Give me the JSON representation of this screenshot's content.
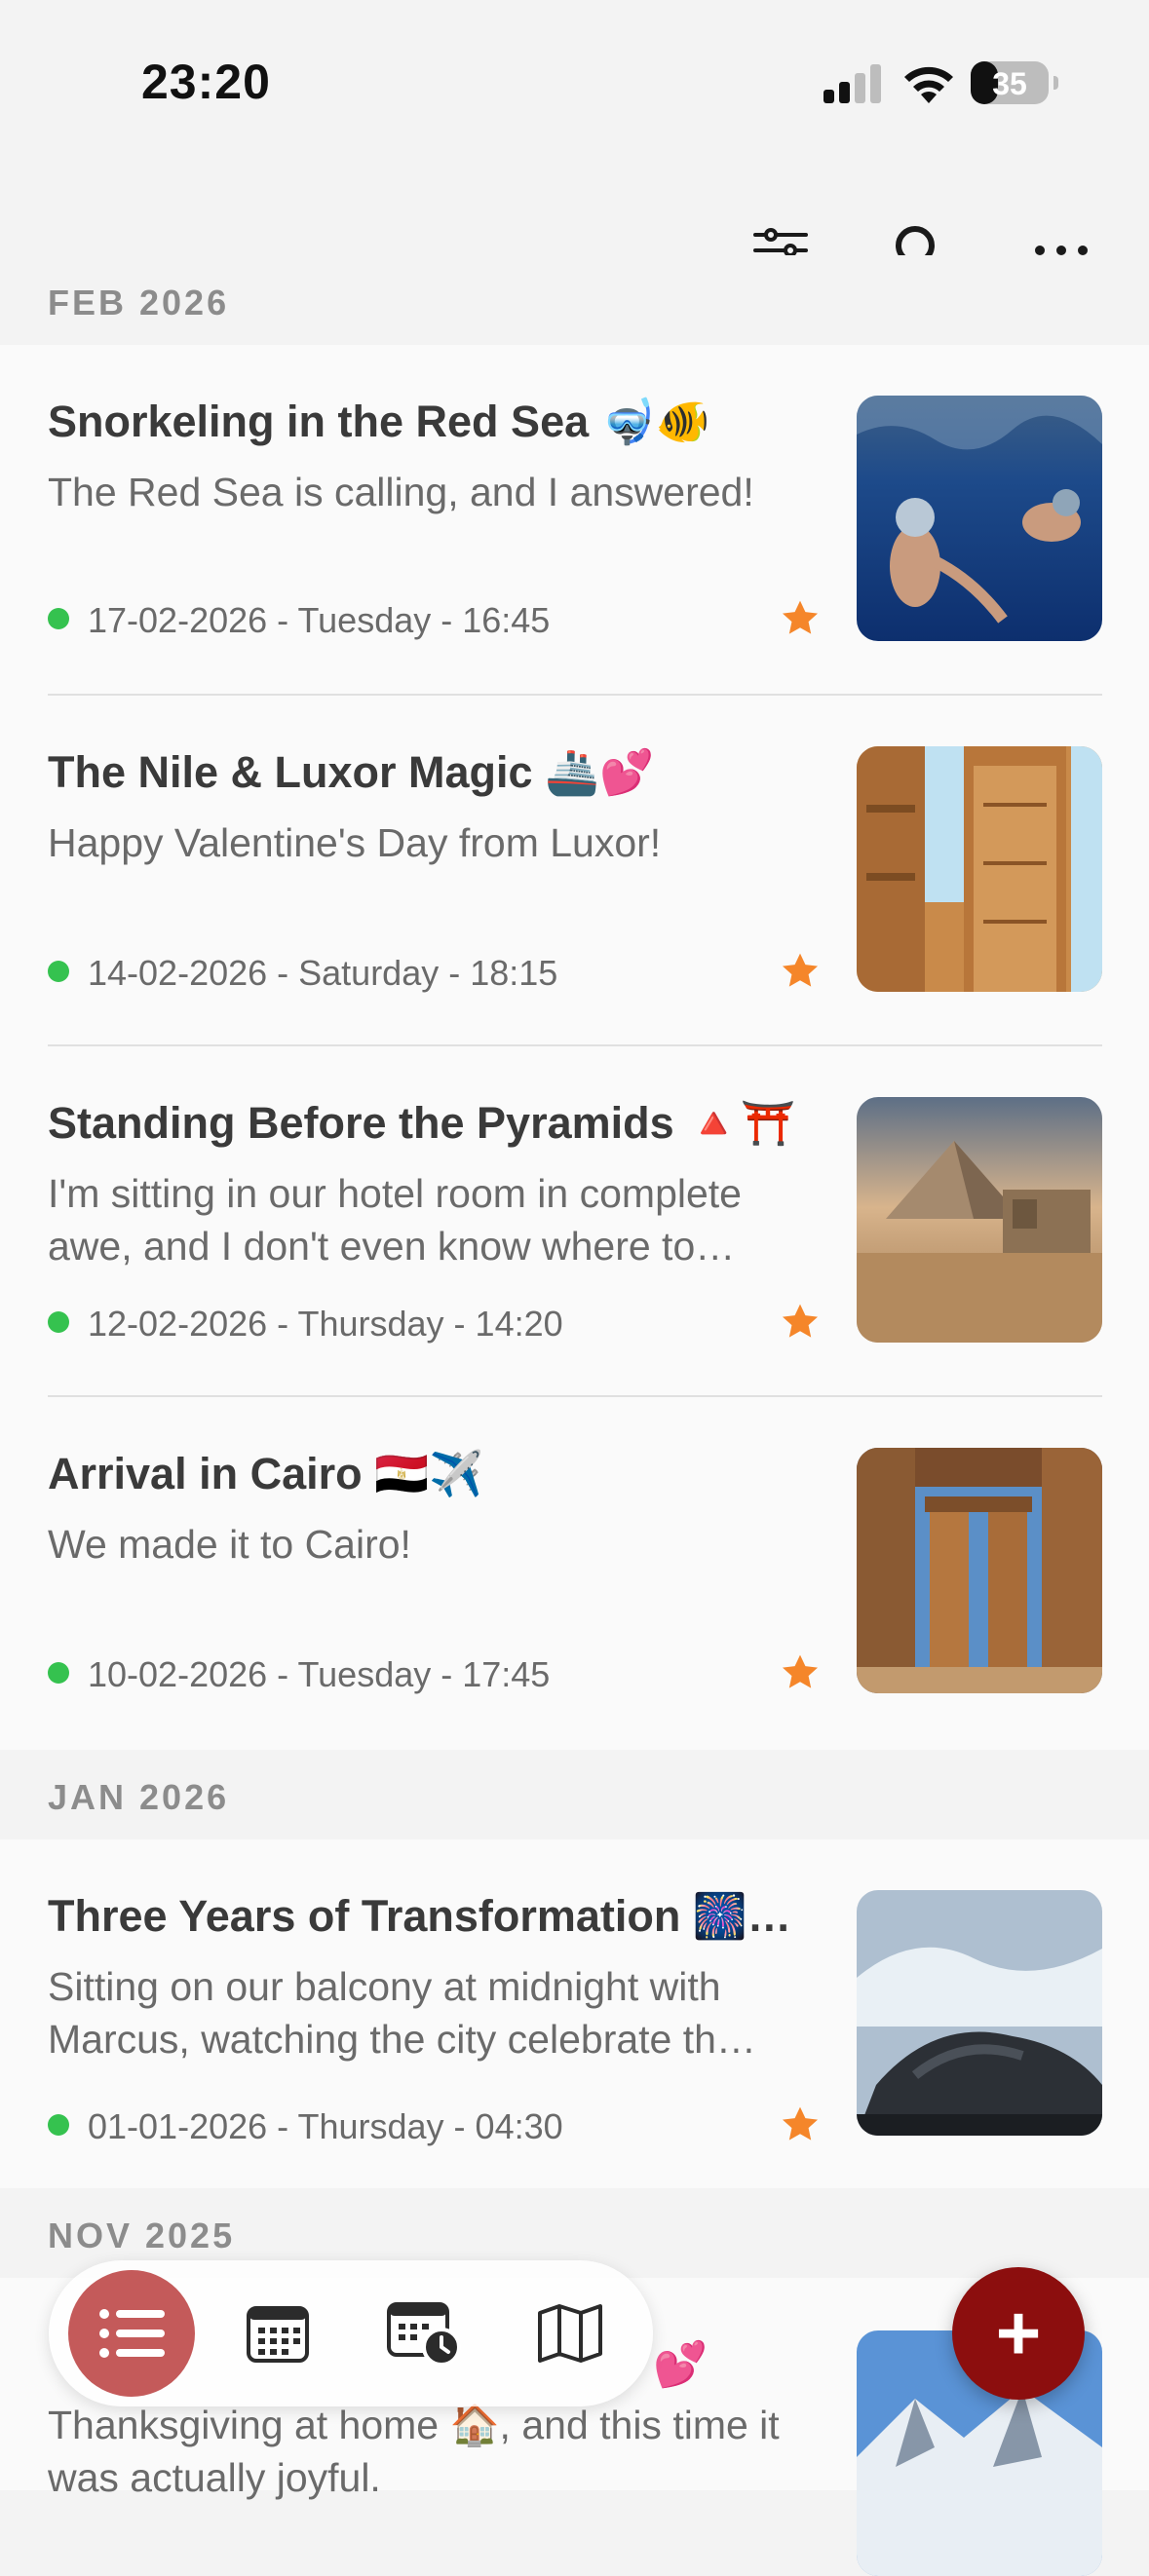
{
  "status_bar": {
    "time": "23:20",
    "battery": "35"
  },
  "toolbar": {
    "icons": [
      "sliders-icon",
      "search-icon",
      "more-icon"
    ]
  },
  "sections": [
    {
      "month": "FEB 2026",
      "entries": [
        {
          "title": "Snorkeling in the Red Sea 🤿🐠",
          "preview": "The Red Sea is calling, and I answered!",
          "date": "17-02-2026 - Tuesday - 16:45",
          "starred": true,
          "thumbnail": "snorkelers-underwater"
        },
        {
          "title": "The Nile & Luxor Magic 🚢💕",
          "preview": "Happy Valentine's Day from Luxor!",
          "date": "14-02-2026 - Saturday - 18:15",
          "starred": true,
          "thumbnail": "luxor-temple-columns"
        },
        {
          "title": "Standing Before the Pyramids 🔺⛩️",
          "preview": "I'm sitting in our hotel room in complete awe, and I don't even know where to start…",
          "date": "12-02-2026 - Thursday - 14:20",
          "starred": true,
          "thumbnail": "pyramid-desert"
        },
        {
          "title": "Arrival in Cairo 🇪🇬✈️",
          "preview": "We made it to Cairo!",
          "date": "10-02-2026 - Tuesday - 17:45",
          "starred": true,
          "thumbnail": "temple-columns-blue-sky"
        }
      ]
    },
    {
      "month": "JAN 2026",
      "entries": [
        {
          "title": "Three Years of Transformation 🎆…",
          "preview": "Sitting on our balcony at midnight with Marcus, watching the city celebrate th…",
          "date": "01-01-2026 - Thursday - 04:30",
          "starred": true,
          "thumbnail": "waves-on-rocks"
        }
      ]
    },
    {
      "month": "NOV 2025",
      "entries": [
        {
          "title": "💕",
          "preview": "Thanksgiving at home 🏠, and this time it was actually joyful.",
          "thumbnail": "snowy-mountains"
        }
      ]
    }
  ],
  "tab_bar": {
    "tabs": [
      {
        "name": "list-icon",
        "active": true
      },
      {
        "name": "calendar-icon",
        "active": false
      },
      {
        "name": "calendar-clock-icon",
        "active": false
      },
      {
        "name": "map-icon",
        "active": false
      }
    ]
  },
  "fab": {
    "label": "+"
  },
  "colors": {
    "accent": "#8c0e0e",
    "active_tab": "#c45a5a",
    "star": "#f5862a",
    "dot": "#35c24f"
  }
}
